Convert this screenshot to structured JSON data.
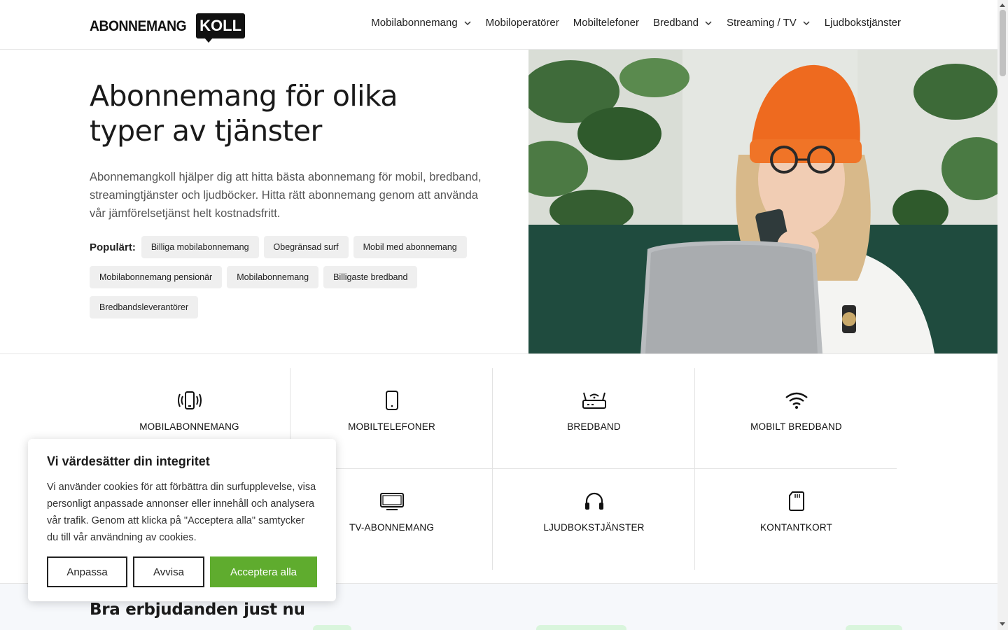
{
  "brand": {
    "logo_word": "ABONNEMANG",
    "logo_box": "KOLL",
    "accent": "#5fac2e"
  },
  "nav": {
    "items": [
      {
        "label": "Mobilabonnemang",
        "dropdown": true
      },
      {
        "label": "Mobiloperatörer",
        "dropdown": false
      },
      {
        "label": "Mobiltelefoner",
        "dropdown": false
      },
      {
        "label": "Bredband",
        "dropdown": true
      },
      {
        "label": "Streaming / TV",
        "dropdown": true
      },
      {
        "label": "Ljudbokstjänster",
        "dropdown": false
      }
    ]
  },
  "hero": {
    "title": "Abonnemang för olika typer av tjänster",
    "description": "Abonnemangkoll hjälper dig att hitta bästa abonnemang för mobil, bredband, streamingtjänster och ljudböcker. Hitta rätt abonnemang genom att använda vår jämförelsetjänst helt kostnadsfritt.",
    "popular_label": "Populärt:",
    "chips": [
      "Billiga mobilabonnemang",
      "Obegränsad surf",
      "Mobil med abonnemang",
      "Mobilabonnemang pensionär",
      "Mobilabonnemang",
      "Billigaste bredband",
      "Bredbandsleverantörer"
    ]
  },
  "categories": [
    {
      "label": "MOBILABONNEMANG",
      "icon": "vibrating-phone-icon"
    },
    {
      "label": "MOBILTELEFONER",
      "icon": "smartphone-icon"
    },
    {
      "label": "BREDBAND",
      "icon": "router-icon"
    },
    {
      "label": "MOBILT BREDBAND",
      "icon": "wifi-icon"
    },
    {
      "label": "",
      "icon": ""
    },
    {
      "label": "TV-ABONNEMANG",
      "icon": "tv-icon"
    },
    {
      "label": "LJUDBOKSTJÄNSTER",
      "icon": "headphones-icon"
    },
    {
      "label": "KONTANTKORT",
      "icon": "sim-card-icon"
    }
  ],
  "offers": {
    "title": "Bra erbjudanden just nu"
  },
  "cookie": {
    "title": "Vi värdesätter din integritet",
    "text": "Vi använder cookies för att förbättra din surfupplevelse, visa personligt anpassade annonser eller innehåll och analysera vår trafik. Genom att klicka på \"Acceptera alla\" samtycker du till vår användning av cookies.",
    "customize_label": "Anpassa",
    "reject_label": "Avvisa",
    "accept_label": "Acceptera alla"
  }
}
